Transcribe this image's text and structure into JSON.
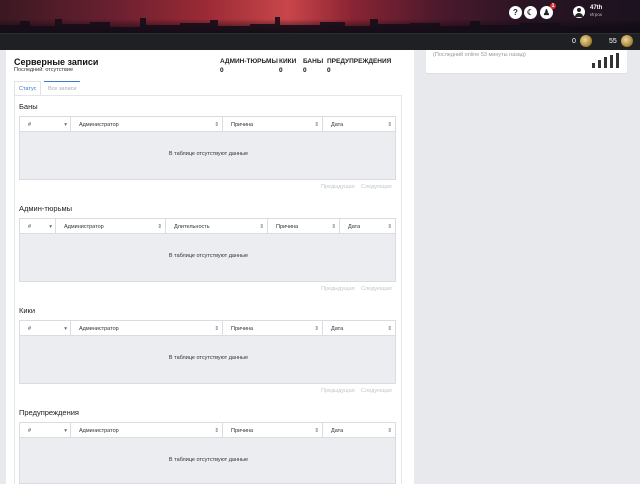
{
  "header": {
    "icons": [
      {
        "name": "help-icon",
        "glyph": "?"
      },
      {
        "name": "moon-icon",
        "glyph": "☾"
      },
      {
        "name": "notification-icon",
        "glyph": "♟",
        "badge": "1"
      }
    ],
    "user": {
      "name": "47th",
      "role": "Игрок"
    }
  },
  "stats_bar": {
    "coins": "0",
    "level": "55"
  },
  "page": {
    "title": "Серверные записи",
    "subtitle": "Последний: отсутствие",
    "summary": [
      {
        "label": "АДМИН-ТЮРЬМЫ",
        "value": "0"
      },
      {
        "label": "КИКИ",
        "value": "0"
      },
      {
        "label": "БАНЫ",
        "value": "0"
      },
      {
        "label": "ПРЕДУПРЕЖДЕНИЯ",
        "value": "0"
      }
    ],
    "tabs": [
      {
        "label": "Статус",
        "active": true
      },
      {
        "label": "Все записи",
        "active": false
      }
    ],
    "empty_text": "В таблице отсутствуют данные",
    "prev_label": "Предыдущая",
    "next_label": "Следующая",
    "sections": [
      {
        "title": "Баны",
        "columns": [
          "#",
          "Администратор",
          "Причина",
          "Дата"
        ]
      },
      {
        "title": "Админ-тюрьмы",
        "columns": [
          "#",
          "Администратор",
          "Длительность",
          "Причина",
          "Дата"
        ]
      },
      {
        "title": "Кики",
        "columns": [
          "#",
          "Администратор",
          "Причина",
          "Дата"
        ]
      },
      {
        "title": "Предупреждения",
        "columns": [
          "#",
          "Администратор",
          "Причина",
          "Дата"
        ]
      }
    ]
  },
  "side_card": {
    "text": "(Последний online 53 минуты назад)"
  },
  "colors": {
    "accent": "#3a7bd5",
    "dark_bar": "#1f2024",
    "table_body": "#ebedf0"
  }
}
